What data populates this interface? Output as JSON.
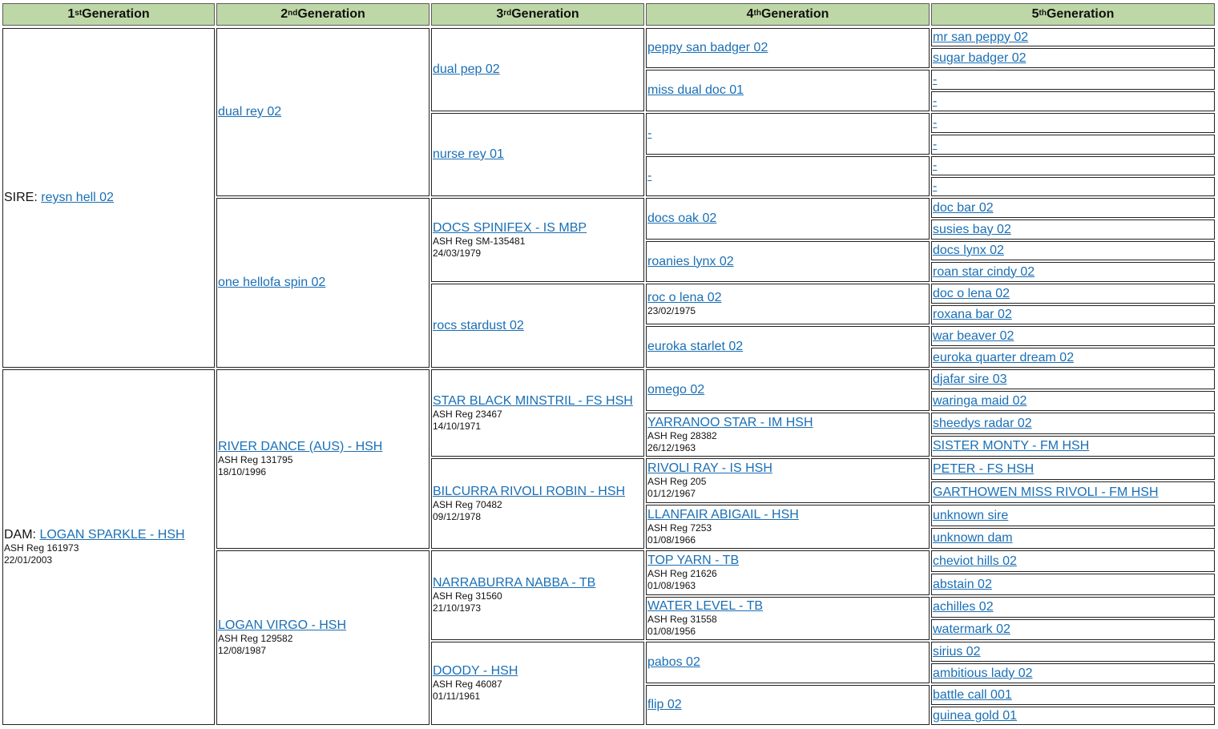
{
  "headers": [
    {
      "num": "1",
      "sup": "st",
      "label": "Generation"
    },
    {
      "num": "2",
      "sup": "nd",
      "label": "Generation"
    },
    {
      "num": "3",
      "sup": "rd",
      "label": "Generation"
    },
    {
      "num": "4",
      "sup": "th",
      "label": "Generation"
    },
    {
      "num": "5",
      "sup": "th",
      "label": "Generation"
    }
  ],
  "gen1": [
    {
      "prefix": "SIRE: ",
      "name": "reysn hell 02",
      "info": []
    },
    {
      "prefix": "DAM: ",
      "name": "LOGAN SPARKLE - HSH",
      "info": [
        "ASH Reg 161973",
        "22/01/2003"
      ]
    }
  ],
  "gen2": [
    {
      "name": "dual rey 02",
      "info": []
    },
    {
      "name": "one hellofa spin 02",
      "info": []
    },
    {
      "name": "RIVER DANCE (AUS) - HSH",
      "info": [
        "ASH Reg 131795",
        "18/10/1996"
      ]
    },
    {
      "name": "LOGAN VIRGO - HSH",
      "info": [
        "ASH Reg 129582",
        "12/08/1987"
      ]
    }
  ],
  "gen3": [
    {
      "name": "dual pep 02",
      "info": []
    },
    {
      "name": "nurse rey 01",
      "info": []
    },
    {
      "name": "DOCS SPINIFEX - IS MBP",
      "info": [
        "ASH Reg SM-135481",
        "24/03/1979"
      ]
    },
    {
      "name": "rocs stardust 02",
      "info": []
    },
    {
      "name": "STAR BLACK MINSTRIL - FS HSH",
      "info": [
        "ASH Reg 23467",
        "14/10/1971"
      ]
    },
    {
      "name": "BILCURRA RIVOLI ROBIN - HSH",
      "info": [
        "ASH Reg 70482",
        "09/12/1978"
      ]
    },
    {
      "name": "NARRABURRA NABBA - TB",
      "info": [
        "ASH Reg 31560",
        "21/10/1973"
      ]
    },
    {
      "name": "DOODY - HSH",
      "info": [
        "ASH Reg 46087",
        "01/11/1961"
      ]
    }
  ],
  "gen4": [
    {
      "name": "peppy san badger 02",
      "info": []
    },
    {
      "name": "miss dual doc 01",
      "info": []
    },
    {
      "name": "-",
      "info": []
    },
    {
      "name": "-",
      "info": []
    },
    {
      "name": "docs oak 02",
      "info": []
    },
    {
      "name": "roanies lynx 02",
      "info": []
    },
    {
      "name": "roc o lena 02",
      "info": [
        "23/02/1975"
      ]
    },
    {
      "name": "euroka starlet 02",
      "info": []
    },
    {
      "name": "omego 02",
      "info": []
    },
    {
      "name": "YARRANOO STAR - IM HSH",
      "info": [
        "ASH Reg 28382",
        "26/12/1963"
      ]
    },
    {
      "name": "RIVOLI RAY - IS HSH",
      "info": [
        "ASH Reg 205",
        "01/12/1967"
      ]
    },
    {
      "name": "LLANFAIR ABIGAIL - HSH",
      "info": [
        "ASH Reg 7253",
        "01/08/1966"
      ]
    },
    {
      "name": "TOP YARN - TB",
      "info": [
        "ASH Reg 21626",
        "01/08/1963"
      ]
    },
    {
      "name": "WATER LEVEL - TB",
      "info": [
        "ASH Reg 31558",
        "01/08/1956"
      ]
    },
    {
      "name": "pabos 02",
      "info": []
    },
    {
      "name": "flip 02",
      "info": []
    }
  ],
  "gen5": [
    {
      "name": "mr san peppy 02"
    },
    {
      "name": "sugar badger 02"
    },
    {
      "name": "-"
    },
    {
      "name": "-"
    },
    {
      "name": "-"
    },
    {
      "name": "-"
    },
    {
      "name": "-"
    },
    {
      "name": "-"
    },
    {
      "name": "doc bar 02"
    },
    {
      "name": "susies bay 02"
    },
    {
      "name": "docs lynx 02"
    },
    {
      "name": "roan star cindy 02"
    },
    {
      "name": "doc o lena 02"
    },
    {
      "name": "roxana bar 02"
    },
    {
      "name": "war beaver 02"
    },
    {
      "name": "euroka quarter dream 02"
    },
    {
      "name": "djafar sire 03"
    },
    {
      "name": "waringa maid 02"
    },
    {
      "name": "sheedys radar 02"
    },
    {
      "name": "SISTER MONTY - FM HSH"
    },
    {
      "name": "PETER - FS HSH"
    },
    {
      "name": "GARTHOWEN MISS RIVOLI - FM HSH"
    },
    {
      "name": "unknown sire"
    },
    {
      "name": "unknown dam"
    },
    {
      "name": "cheviot hills 02"
    },
    {
      "name": "abstain 02"
    },
    {
      "name": "achilles 02"
    },
    {
      "name": "watermark 02"
    },
    {
      "name": "sirius 02"
    },
    {
      "name": "ambitious lady 02"
    },
    {
      "name": "battle call 001"
    },
    {
      "name": "guinea gold 01"
    }
  ]
}
